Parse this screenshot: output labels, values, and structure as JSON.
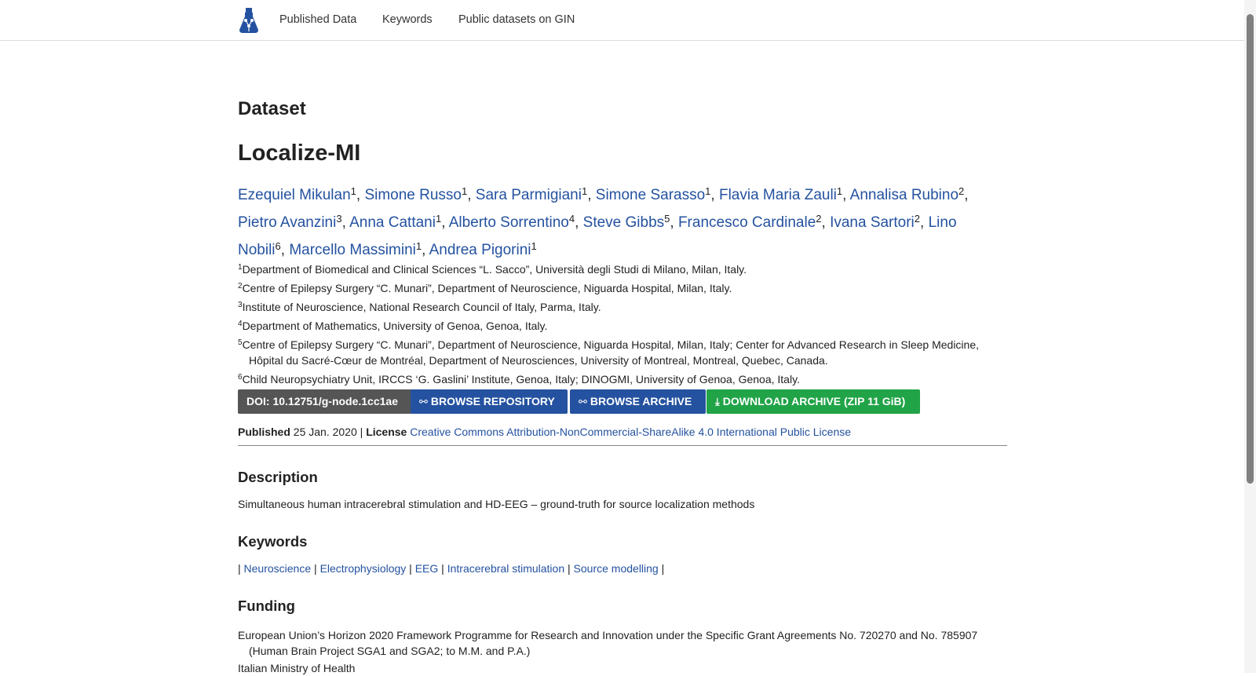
{
  "nav": {
    "logo_name": "gnode-logo",
    "items": [
      "Published Data",
      "Keywords",
      "Public datasets on GIN"
    ]
  },
  "page": {
    "section_heading": "Dataset",
    "title": "Localize-MI"
  },
  "authors": [
    {
      "name": "Ezequiel Mikulan",
      "sup": "1"
    },
    {
      "name": "Simone Russo",
      "sup": "1"
    },
    {
      "name": "Sara Parmigiani",
      "sup": "1"
    },
    {
      "name": "Simone Sarasso",
      "sup": "1"
    },
    {
      "name": "Flavia Maria Zauli",
      "sup": "1"
    },
    {
      "name": "Annalisa Rubino",
      "sup": "2"
    },
    {
      "name": "Pietro Avanzini",
      "sup": "3"
    },
    {
      "name": "Anna Cattani",
      "sup": "1"
    },
    {
      "name": "Alberto Sorrentino",
      "sup": "4"
    },
    {
      "name": "Steve Gibbs",
      "sup": "5"
    },
    {
      "name": "Francesco Cardinale",
      "sup": "2"
    },
    {
      "name": "Ivana Sartori",
      "sup": "2"
    },
    {
      "name": "Lino Nobili",
      "sup": "6"
    },
    {
      "name": "Marcello Massimini",
      "sup": "1"
    },
    {
      "name": "Andrea Pigorini",
      "sup": "1"
    }
  ],
  "affiliations": [
    {
      "num": "1",
      "text": "Department of Biomedical and Clinical Sciences “L. Sacco”, Università degli Studi di Milano, Milan, Italy."
    },
    {
      "num": "2",
      "text": "Centre of Epilepsy Surgery “C. Munari”, Department of Neuroscience, Niguarda Hospital, Milan, Italy."
    },
    {
      "num": "3",
      "text": "Institute of Neuroscience, National Research Council of Italy, Parma, Italy."
    },
    {
      "num": "4",
      "text": "Department of Mathematics, University of Genoa, Genoa, Italy."
    },
    {
      "num": "5",
      "text": "Centre of Epilepsy Surgery “C. Munari”, Department of Neuroscience, Niguarda Hospital, Milan, Italy; Center for Advanced Research in Sleep Medicine, Hôpital du Sacré-Cœur de Montréal, Department of Neurosciences, University of Montreal, Montreal, Quebec, Canada."
    },
    {
      "num": "6",
      "text": "Child Neuropsychiatry Unit, IRCCS ‘G. Gaslini’ Institute, Genoa, Italy; DINOGMI, University of Genoa, Genoa, Italy."
    }
  ],
  "buttons": {
    "doi": "DOI: 10.12751/g-node.1cc1ae",
    "browse_repository": "BROWSE REPOSITORY",
    "browse_archive": "BROWSE ARCHIVE",
    "download_archive": "DOWNLOAD ARCHIVE (ZIP 11 GiB)"
  },
  "pubinfo": {
    "published_label": "Published",
    "published_date": "25 Jan. 2020",
    "separator": "|",
    "license_label": "License",
    "license_link": "Creative Commons Attribution-NonCommercial-ShareAlike 4.0 International Public License"
  },
  "description": {
    "heading": "Description",
    "text": "Simultaneous human intracerebral stimulation and HD-EEG – ground-truth for source localization methods"
  },
  "keywords": {
    "heading": "Keywords",
    "items": [
      "Neuroscience",
      "Electrophysiology",
      "EEG",
      "Intracerebral stimulation",
      "Source modelling"
    ]
  },
  "funding": {
    "heading": "Funding",
    "items": [
      "European Union’s Horizon 2020 Framework Programme for Research and Innovation under the Specific Grant Agreements No. 720270 and No. 785907 (Human Brain Project SGA1 and SGA2; to M.M. and P.A.)",
      "Italian Ministry of Health"
    ]
  },
  "colors": {
    "link": "#2452a0",
    "doi_button": "#555555",
    "browse_button": "#2452a0",
    "download_button": "#21a347"
  }
}
